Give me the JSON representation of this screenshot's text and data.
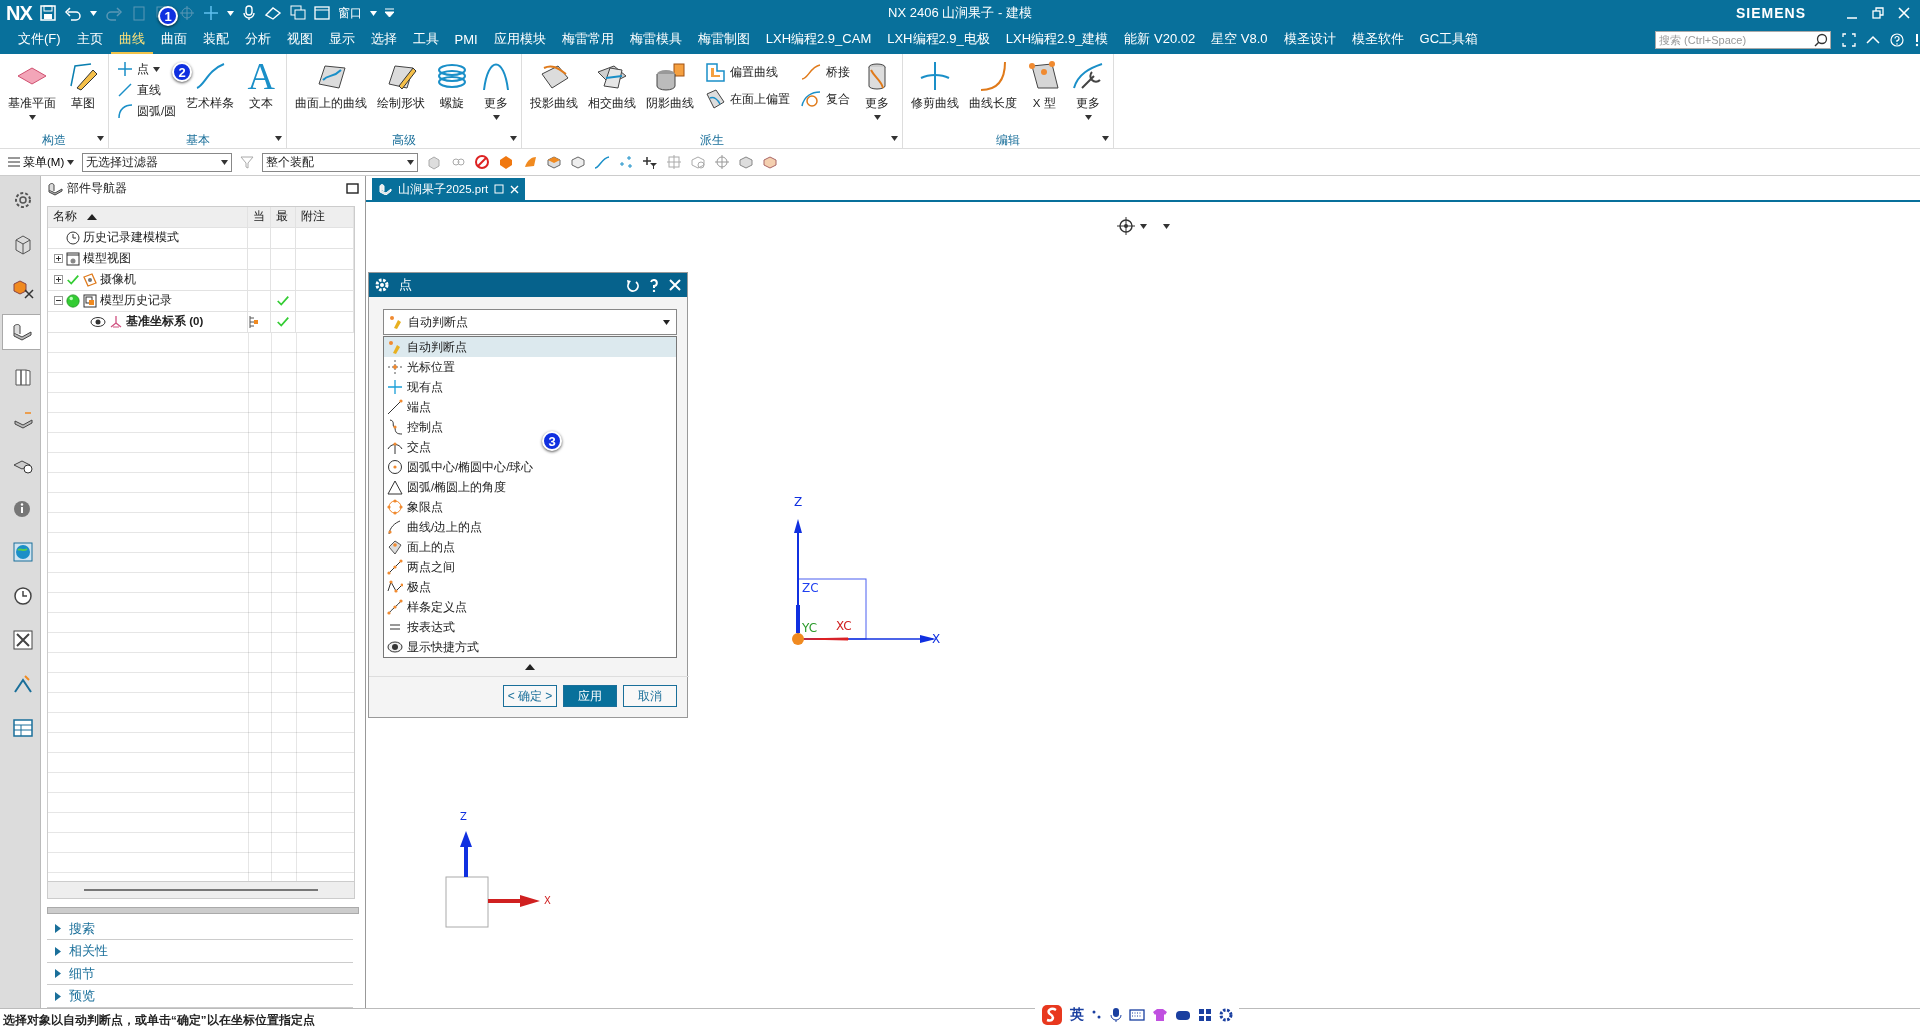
{
  "window": {
    "logo": "NX",
    "title": "NX 2406 山涧果子 - 建模",
    "brand": "SIEMENS"
  },
  "quick_access": {
    "window_menu": "窗口"
  },
  "menu_tabs": [
    {
      "label": "文件(F)",
      "selected": false
    },
    {
      "label": "主页",
      "selected": false
    },
    {
      "label": "曲线",
      "selected": true
    },
    {
      "label": "曲面",
      "selected": false
    },
    {
      "label": "装配",
      "selected": false
    },
    {
      "label": "分析",
      "selected": false
    },
    {
      "label": "视图",
      "selected": false
    },
    {
      "label": "显示",
      "selected": false
    },
    {
      "label": "选择",
      "selected": false
    },
    {
      "label": "工具",
      "selected": false
    },
    {
      "label": "PMI",
      "selected": false
    },
    {
      "label": "应用模块",
      "selected": false
    },
    {
      "label": "梅雷常用",
      "selected": false
    },
    {
      "label": "梅雷模具",
      "selected": false
    },
    {
      "label": "梅雷制图",
      "selected": false
    },
    {
      "label": "LXH编程2.9_CAM",
      "selected": false
    },
    {
      "label": "LXH编程2.9_电极",
      "selected": false
    },
    {
      "label": "LXH编程2.9_建模",
      "selected": false
    },
    {
      "label": "能新 V20.02",
      "selected": false
    },
    {
      "label": "星空 V8.0",
      "selected": false
    },
    {
      "label": "模圣设计",
      "selected": false
    },
    {
      "label": "模圣软件",
      "selected": false
    },
    {
      "label": "GC工具箱",
      "selected": false
    }
  ],
  "search": {
    "placeholder": "搜索 (Ctrl+Space)"
  },
  "ribbon_groups": [
    {
      "title": "构造",
      "items": [
        {
          "kind": "large",
          "label": "基准平面",
          "dropdown": true
        },
        {
          "kind": "large",
          "label": "草图",
          "dropdown": false
        }
      ]
    },
    {
      "title": "基本",
      "items": [
        {
          "kind": "stack",
          "items": [
            {
              "label": "点",
              "dropdown": true
            },
            {
              "label": "直线",
              "dropdown": false
            },
            {
              "label": "圆弧/圆",
              "dropdown": false
            }
          ]
        },
        {
          "kind": "large",
          "label": "艺术样条",
          "dropdown": false
        },
        {
          "kind": "glyph",
          "glyph": "A",
          "label": "文本",
          "dropdown": false
        }
      ]
    },
    {
      "title": "高级",
      "items": [
        {
          "kind": "large",
          "label": "曲面上的曲线",
          "dropdown": false
        },
        {
          "kind": "large",
          "label": "绘制形状",
          "dropdown": false
        },
        {
          "kind": "large",
          "label": "螺旋",
          "dropdown": false
        },
        {
          "kind": "large",
          "label": "更多",
          "dropdown": true
        }
      ]
    },
    {
      "title": "派生",
      "items": [
        {
          "kind": "large",
          "label": "投影曲线",
          "dropdown": false
        },
        {
          "kind": "large",
          "label": "相交曲线",
          "dropdown": false
        },
        {
          "kind": "large",
          "label": "阴影曲线",
          "dropdown": false
        },
        {
          "kind": "stack",
          "items": [
            {
              "label": "偏置曲线",
              "dropdown": false
            },
            {
              "label": "在面上偏置",
              "dropdown": false
            }
          ]
        },
        {
          "kind": "stack",
          "items": [
            {
              "label": "桥接",
              "dropdown": false
            },
            {
              "label": "复合",
              "dropdown": false
            }
          ]
        },
        {
          "kind": "large",
          "label": "更多",
          "dropdown": true
        }
      ]
    },
    {
      "title": "编辑",
      "items": [
        {
          "kind": "large",
          "label": "修剪曲线",
          "dropdown": false
        },
        {
          "kind": "large",
          "label": "曲线长度",
          "dropdown": false
        },
        {
          "kind": "large",
          "label": "X 型",
          "dropdown": false
        },
        {
          "kind": "large",
          "label": "更多",
          "dropdown": true
        }
      ]
    }
  ],
  "toolbar": {
    "menu": "菜单(M)",
    "filter": "无选择过滤器",
    "scope": "整个装配"
  },
  "resource_bar": [
    {
      "selected": false
    },
    {
      "selected": false
    },
    {
      "selected": false
    },
    {
      "selected": true
    },
    {
      "selected": false
    },
    {
      "selected": false
    },
    {
      "selected": false
    },
    {
      "selected": false
    },
    {
      "selected": false
    },
    {
      "selected": false
    },
    {
      "selected": false
    },
    {
      "selected": false
    },
    {
      "selected": false
    }
  ],
  "navigator": {
    "title": "部件导航器",
    "columns": [
      "名称",
      "当",
      "最",
      "附注"
    ],
    "tree": [
      {
        "label": "历史记录建模模式",
        "checked": false,
        "latest": false
      },
      {
        "label": "模型视图",
        "expanded": false,
        "checked": false,
        "latest": false
      },
      {
        "label": "摄像机",
        "expanded": false,
        "checked": true,
        "latest": false
      },
      {
        "label": "模型历史记录",
        "expanded": true,
        "checked": false,
        "latest": true,
        "children": [
          {
            "label": "基准坐标系 (0)",
            "checked": false,
            "latest": true
          }
        ]
      }
    ],
    "sections": [
      {
        "label": "搜索",
        "expanded": false
      },
      {
        "label": "相关性",
        "expanded": false
      },
      {
        "label": "细节",
        "expanded": false
      },
      {
        "label": "预览",
        "expanded": false
      }
    ]
  },
  "document_tab": {
    "label": "山涧果子2025.prt",
    "selected": true
  },
  "dialog": {
    "title": "点",
    "type_value": "自动判断点",
    "options": [
      {
        "label": "自动判断点",
        "selected": true
      },
      {
        "label": "光标位置",
        "selected": false
      },
      {
        "label": "现有点",
        "selected": false
      },
      {
        "label": "端点",
        "selected": false
      },
      {
        "label": "控制点",
        "selected": false
      },
      {
        "label": "交点",
        "selected": false
      },
      {
        "label": "圆弧中心/椭圆中心/球心",
        "selected": false
      },
      {
        "label": "圆弧/椭圆上的角度",
        "selected": false
      },
      {
        "label": "象限点",
        "selected": false
      },
      {
        "label": "曲线/边上的点",
        "selected": false
      },
      {
        "label": "面上的点",
        "selected": false
      },
      {
        "label": "两点之间",
        "selected": false
      },
      {
        "label": "极点",
        "selected": false
      },
      {
        "label": "样条定义点",
        "selected": false
      },
      {
        "label": "按表达式",
        "selected": false
      },
      {
        "label": "显示快捷方式",
        "selected": false
      }
    ],
    "buttons": [
      {
        "label": "< 确定 >",
        "kind": "secondary"
      },
      {
        "label": "应用",
        "kind": "primary"
      },
      {
        "label": "取消",
        "kind": "secondary"
      }
    ]
  },
  "csys": {
    "z": "Z",
    "zc": "ZC",
    "yc": "YC",
    "xc": "XC",
    "x": "X"
  },
  "view_triad": {
    "z": "Z",
    "x": "X"
  },
  "callouts": [
    "1",
    "2",
    "3"
  ],
  "status_bar": {
    "message": "选择对象以自动判断点，或单击“确定”以在坐标位置指定点"
  },
  "ime": {
    "mode": "英"
  }
}
